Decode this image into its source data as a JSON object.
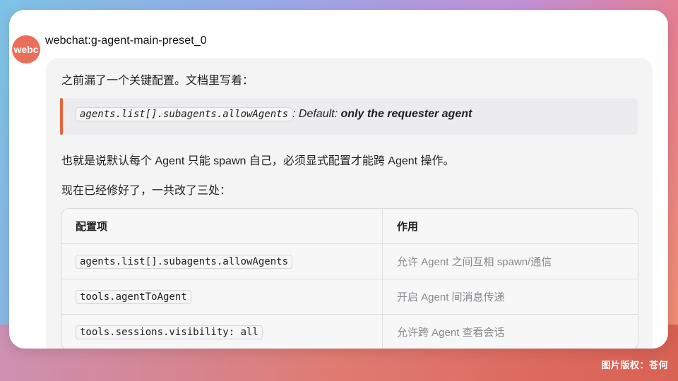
{
  "sender": {
    "avatar_text": "webc",
    "name": "webchat:g-agent-main-preset_0"
  },
  "message": {
    "intro": "之前漏了一个关键配置。文档里写着：",
    "quote": {
      "code": "agents.list[].subagents.allowAgents",
      "prefix": ": Default: ",
      "emphasis": "only the requester agent"
    },
    "explanation": "也就是说默认每个 Agent 只能 spawn 自己，必须显式配置才能跨 Agent 操作。",
    "summary": "现在已经修好了，一共改了三处：",
    "table": {
      "headers": [
        "配置项",
        "作用"
      ],
      "rows": [
        {
          "key": "agents.list[].subagents.allowAgents",
          "effect": "允许 Agent 之间互相 spawn/通信"
        },
        {
          "key": "tools.agentToAgent",
          "effect": "开启 Agent 间消息传递"
        },
        {
          "key": "tools.sessions.visibility: all",
          "effect": "允许跨 Agent 查看会话"
        }
      ]
    }
  },
  "credit": "图片版权：苍何",
  "colors": {
    "avatar": "#ea6f5a",
    "quote_bar": "#e8643f"
  }
}
